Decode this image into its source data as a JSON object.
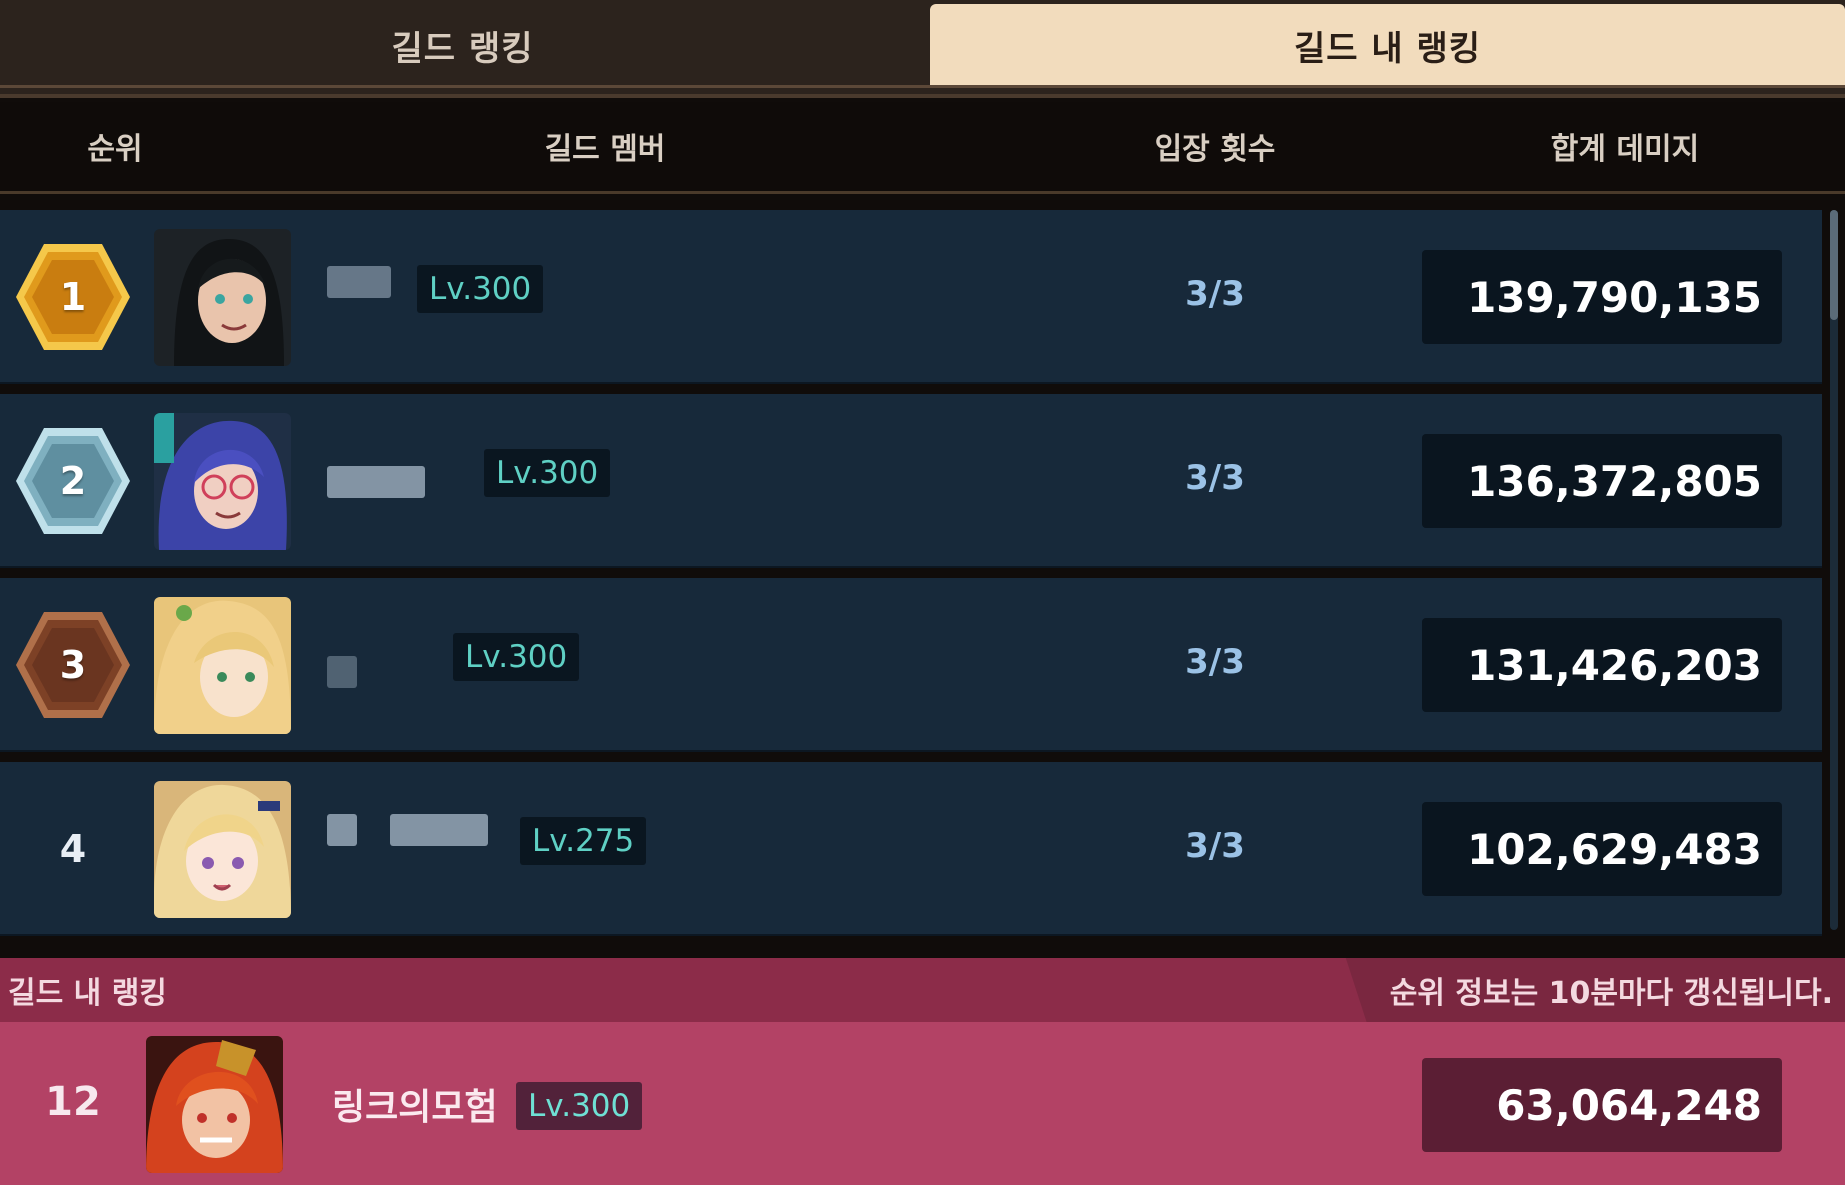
{
  "tabs": [
    {
      "label": "길드 랭킹",
      "active": false
    },
    {
      "label": "길드 내 랭킹",
      "active": true
    }
  ],
  "columns": {
    "rank": "순위",
    "member": "길드 멤버",
    "entries": "입장 횟수",
    "damage": "합계 데미지"
  },
  "rows": [
    {
      "rank": "1",
      "medal": "gold",
      "level": "Lv.300",
      "entries": "3/3",
      "damage": "139,790,135"
    },
    {
      "rank": "2",
      "medal": "silver",
      "level": "Lv.300",
      "entries": "3/3",
      "damage": "136,372,805"
    },
    {
      "rank": "3",
      "medal": "bronze",
      "level": "Lv.300",
      "entries": "3/3",
      "damage": "131,426,203"
    },
    {
      "rank": "4",
      "medal": "none",
      "level": "Lv.275",
      "entries": "3/3",
      "damage": "102,629,483"
    }
  ],
  "my_ranking": {
    "title": "길드 내 랭킹",
    "notice": "순위 정보는 10분마다 갱신됩니다.",
    "rank": "12",
    "name": "링크의모험",
    "level": "Lv.300",
    "damage": "63,064,248"
  },
  "colors": {
    "gold": "#e2a020",
    "silver": "#8fb7c8",
    "bronze": "#8a4a2c",
    "accent_level": "#5fd0c4",
    "my_bar": "#b34265"
  }
}
